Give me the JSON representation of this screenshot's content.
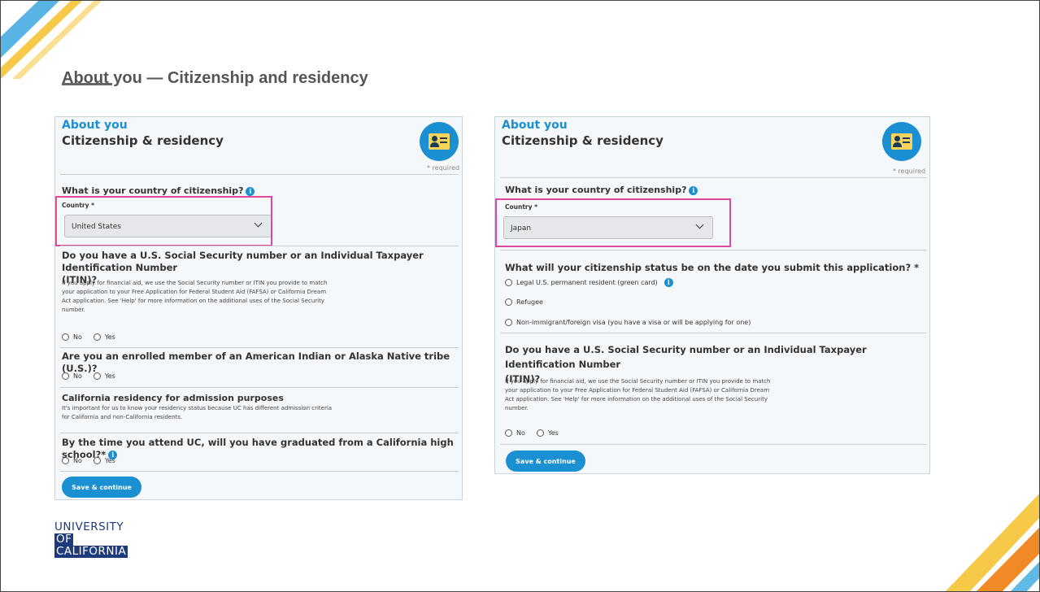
{
  "slide": {
    "title": "About you — Citizenship and residency"
  },
  "colors": {
    "accent": "#1a8fd1",
    "highlight": "#e0479e",
    "stripe_yellow": "#f7c948",
    "stripe_orange": "#f08a24",
    "stripe_blue": "#3aa7e0",
    "logo_blue": "#1d3b7a"
  },
  "left_panel": {
    "kicker": "About you",
    "heading": "Citizenship & residency",
    "badge_icon": "id-card-icon",
    "required_note": "* required",
    "country_question": "What is your country of citizenship?",
    "country_label": "Country *",
    "country_value": "United States",
    "ssn_question_line1": "Do you have a U.S. Social Security number or an Individual Taxpayer Identification Number",
    "ssn_question_line2": "(ITIN)?",
    "ssn_help": [
      "If you apply for financial aid, we use the Social Security number or ITIN you provide to match",
      "your application to your Free Application for Federal Student Aid (FAFSA) or California Dream",
      "Act application. See 'Help' for more information on the additional uses of the Social Security",
      "number."
    ],
    "ssn_no": "No",
    "ssn_yes": "Yes",
    "tribe_question": "Are you an enrolled member of an American Indian or Alaska Native tribe (U.S.)?",
    "tribe_no": "No",
    "tribe_yes": "Yes",
    "residency_heading": "California residency for admission purposes",
    "residency_help": [
      "It's important for us to know your residency status because UC has different admission criteria",
      "for California and non-California residents."
    ],
    "graduate_question": "By the time you attend UC, will you have graduated from a California high school?*",
    "grad_no": "No",
    "grad_yes": "Yes",
    "save_label": "Save & continue"
  },
  "right_panel": {
    "kicker": "About you",
    "heading": "Citizenship & residency",
    "badge_icon": "id-card-icon",
    "required_note": "* required",
    "country_question": "What is your country of citizenship?",
    "country_label": "Country *",
    "country_value": "Japan",
    "status_question": "What will your citizenship status be on the date you submit this application? *",
    "status_options": [
      "Legal U.S. permanent resident (green card)",
      "Refugee",
      "Non-immigrant/foreign visa (you have a visa or will be applying for one)"
    ],
    "ssn_question_line1": "Do you have a U.S. Social Security number or an Individual Taxpayer Identification Number",
    "ssn_question_line2": "(ITIN)?",
    "ssn_help": [
      "If you apply for financial aid, we use the Social Security number or ITIN you provide to match",
      "your application to your Free Application for Federal Student Aid (FAFSA) or California Dream",
      "Act application. See 'Help' for more information on the additional uses of the Social Security",
      "number."
    ],
    "ssn_no": "No",
    "ssn_yes": "Yes",
    "save_label": "Save & continue"
  },
  "logo": {
    "line1": "UNIVERSITY",
    "line2": "OF",
    "line3": "CALIFORNIA"
  }
}
